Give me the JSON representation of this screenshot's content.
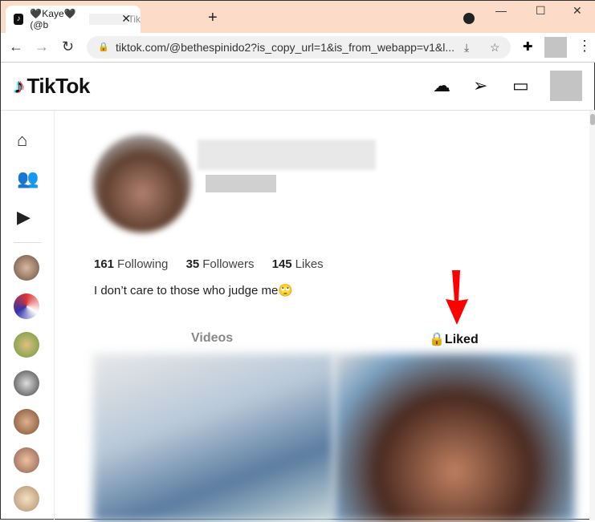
{
  "browser": {
    "tab_title_prefix": "🖤Kaye🖤 (@b",
    "tab_title_suffix": "Tik",
    "url": "tiktok.com/@bethespinido2?is_copy_url=1&is_from_webapp=v1&l..."
  },
  "header": {
    "logo": "TikTok"
  },
  "profile": {
    "stats": [
      {
        "value": "161",
        "label": "Following"
      },
      {
        "value": "35",
        "label": "Followers"
      },
      {
        "value": "145",
        "label": "Likes"
      }
    ],
    "bio": "I don’t care to those who judge me🙄"
  },
  "tabs": [
    {
      "label": "Videos"
    },
    {
      "label": "Liked"
    }
  ],
  "colors": {
    "arrow": "#ff0000",
    "accent": "#fe2c55"
  }
}
